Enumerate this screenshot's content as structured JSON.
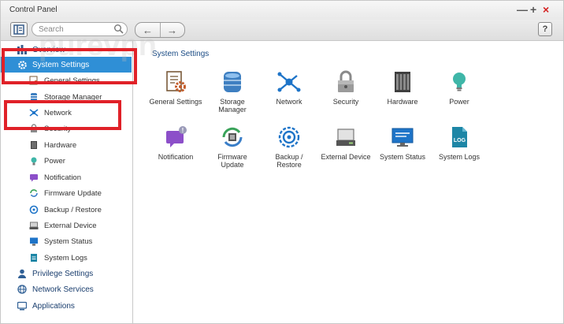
{
  "window": {
    "title": "Control Panel",
    "controls": {
      "minimize": "—",
      "maximize": "+",
      "close": "×"
    }
  },
  "toolbar": {
    "search_placeholder": "Search",
    "back": "←",
    "forward": "→",
    "help": "?"
  },
  "watermark": "purevpn",
  "sidebar": {
    "overview": "Overview",
    "system_settings": "System Settings",
    "items": [
      {
        "label": "General Settings",
        "icon": "general-settings-icon"
      },
      {
        "label": "Storage Manager",
        "icon": "storage-manager-icon"
      },
      {
        "label": "Network",
        "icon": "network-icon"
      },
      {
        "label": "Security",
        "icon": "security-icon"
      },
      {
        "label": "Hardware",
        "icon": "hardware-icon"
      },
      {
        "label": "Power",
        "icon": "power-icon"
      },
      {
        "label": "Notification",
        "icon": "notification-icon"
      },
      {
        "label": "Firmware Update",
        "icon": "firmware-update-icon"
      },
      {
        "label": "Backup / Restore",
        "icon": "backup-restore-icon"
      },
      {
        "label": "External Device",
        "icon": "external-device-icon"
      },
      {
        "label": "System Status",
        "icon": "system-status-icon"
      },
      {
        "label": "System Logs",
        "icon": "system-logs-icon"
      }
    ],
    "privilege_settings": "Privilege Settings",
    "network_services": "Network Services",
    "applications": "Applications"
  },
  "main": {
    "section_title": "System Settings",
    "apps": [
      {
        "line1": "General Settings",
        "line2": ""
      },
      {
        "line1": "Storage",
        "line2": "Manager"
      },
      {
        "line1": "Network",
        "line2": ""
      },
      {
        "line1": "Security",
        "line2": ""
      },
      {
        "line1": "Hardware",
        "line2": ""
      },
      {
        "line1": "Power",
        "line2": ""
      },
      {
        "line1": "Notification",
        "line2": ""
      },
      {
        "line1": "Firmware",
        "line2": "Update"
      },
      {
        "line1": "Backup /",
        "line2": "Restore"
      },
      {
        "line1": "External Device",
        "line2": ""
      },
      {
        "line1": "System Status",
        "line2": ""
      },
      {
        "line1": "System Logs",
        "line2": ""
      }
    ],
    "notification_badge": "!",
    "logs_icon_text": "LOG"
  },
  "colors": {
    "highlight": "#2f8fd6",
    "annotation_red": "#e02128",
    "section_title": "#1a4b84"
  }
}
